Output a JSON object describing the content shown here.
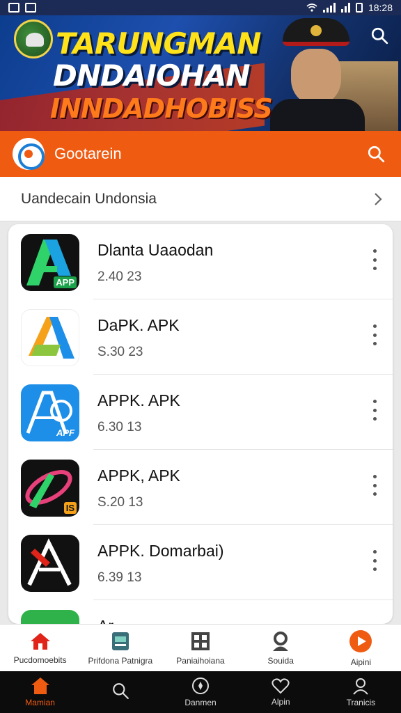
{
  "status_bar": {
    "time": "18:28"
  },
  "banner": {
    "line1": "TARUNGMAN",
    "line2": "DNDAIOHAN",
    "line3": "INNDADHOBISS"
  },
  "topbar": {
    "title": "Gootarein"
  },
  "category": {
    "label": "Uandecain Undonsia"
  },
  "apps": [
    {
      "title": "Dlanta Uaaodan",
      "meta": "2.40 23",
      "icon": "app-a-icon",
      "badge": "APP"
    },
    {
      "title": "DaPK. APK",
      "meta": "S.30 23",
      "icon": "apk-a-orange-icon",
      "badge": ""
    },
    {
      "title": "APPK. APK",
      "meta": "6.30 13",
      "icon": "apf-blue-icon",
      "badge": "APF"
    },
    {
      "title": "APPK, APK",
      "meta": "S.20 13",
      "icon": "ring-orange-icon",
      "badge": "IS"
    },
    {
      "title": "APPK. Domarbai)",
      "meta": "6.39 13",
      "icon": "red-a-icon",
      "badge": ""
    },
    {
      "title": "Ar...",
      "meta": "",
      "icon": "green-app-icon",
      "badge": ""
    }
  ],
  "category_tabs": [
    {
      "label": "Pucdomoebits",
      "icon": "house-icon",
      "color": "#e0241a"
    },
    {
      "label": "Prifdona Patnigra",
      "icon": "card-icon",
      "color": "#3a6f7a"
    },
    {
      "label": "Paniaihoiana",
      "icon": "grid-icon",
      "color": "#444444"
    },
    {
      "label": "Souida",
      "icon": "person-icon",
      "color": "#444444"
    },
    {
      "label": "Aipini",
      "icon": "play-icon",
      "color": "#f05b12"
    }
  ],
  "bottom_nav": [
    {
      "label": "Mamian",
      "icon": "home-icon",
      "active": true
    },
    {
      "label": "",
      "icon": "search-icon",
      "active": false
    },
    {
      "label": "Danmen",
      "icon": "compass-icon",
      "active": false
    },
    {
      "label": "Alpin",
      "icon": "heart-icon",
      "active": false
    },
    {
      "label": "Tranicis",
      "icon": "profile-icon",
      "active": false
    }
  ],
  "colors": {
    "accent": "#f05b12",
    "banner_bg": "#1e4fae",
    "nav_bg": "#0c0c0c"
  }
}
